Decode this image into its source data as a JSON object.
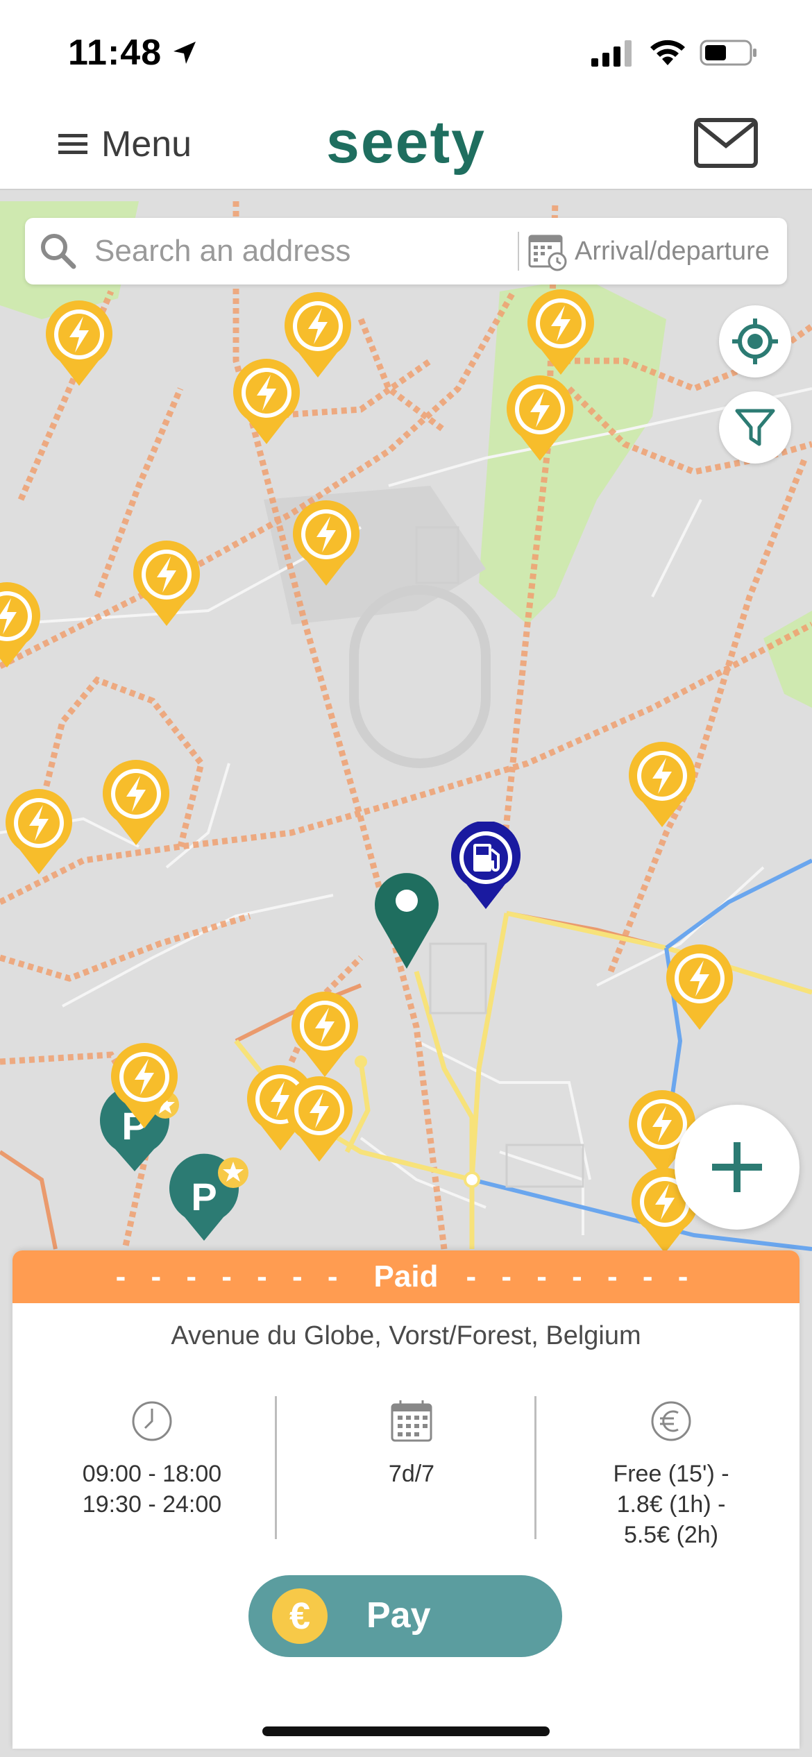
{
  "status_bar": {
    "time": "11:48"
  },
  "header": {
    "menu_label": "Menu",
    "logo": "seety"
  },
  "search": {
    "placeholder": "Search an address",
    "arrival_label": "Arrival/departure"
  },
  "card": {
    "banner": "Paid",
    "banner_dashes": "- - - - - - -",
    "address": "Avenue du Globe, Vorst/Forest, Belgium",
    "hours": [
      "09:00 - 18:00",
      "19:30 - 24:00"
    ],
    "days": "7d/7",
    "price": [
      "Free (15') -",
      "1.8€ (1h) -",
      "5.5€ (2h)"
    ],
    "pay_label": "Pay",
    "pay_icon": "€"
  },
  "colors": {
    "brand": "#1f6e5f",
    "charger_pin": "#f7bd2b",
    "paid_banner": "#ff9c51",
    "pay_button": "#5b9d9f",
    "fuel_pin": "#1a1aa0",
    "parking_pin": "#2c7b73"
  },
  "icons": [
    "location-arrow-icon",
    "signal-icon",
    "wifi-icon",
    "battery-icon",
    "hamburger-icon",
    "mail-icon",
    "search-icon",
    "calendar-clock-icon",
    "locate-icon",
    "filter-icon",
    "plus-icon",
    "charger-pin-icon",
    "fuel-pin-icon",
    "parking-pin-icon",
    "selected-location-pin-icon",
    "clock-icon",
    "calendar-icon",
    "euro-icon"
  ]
}
